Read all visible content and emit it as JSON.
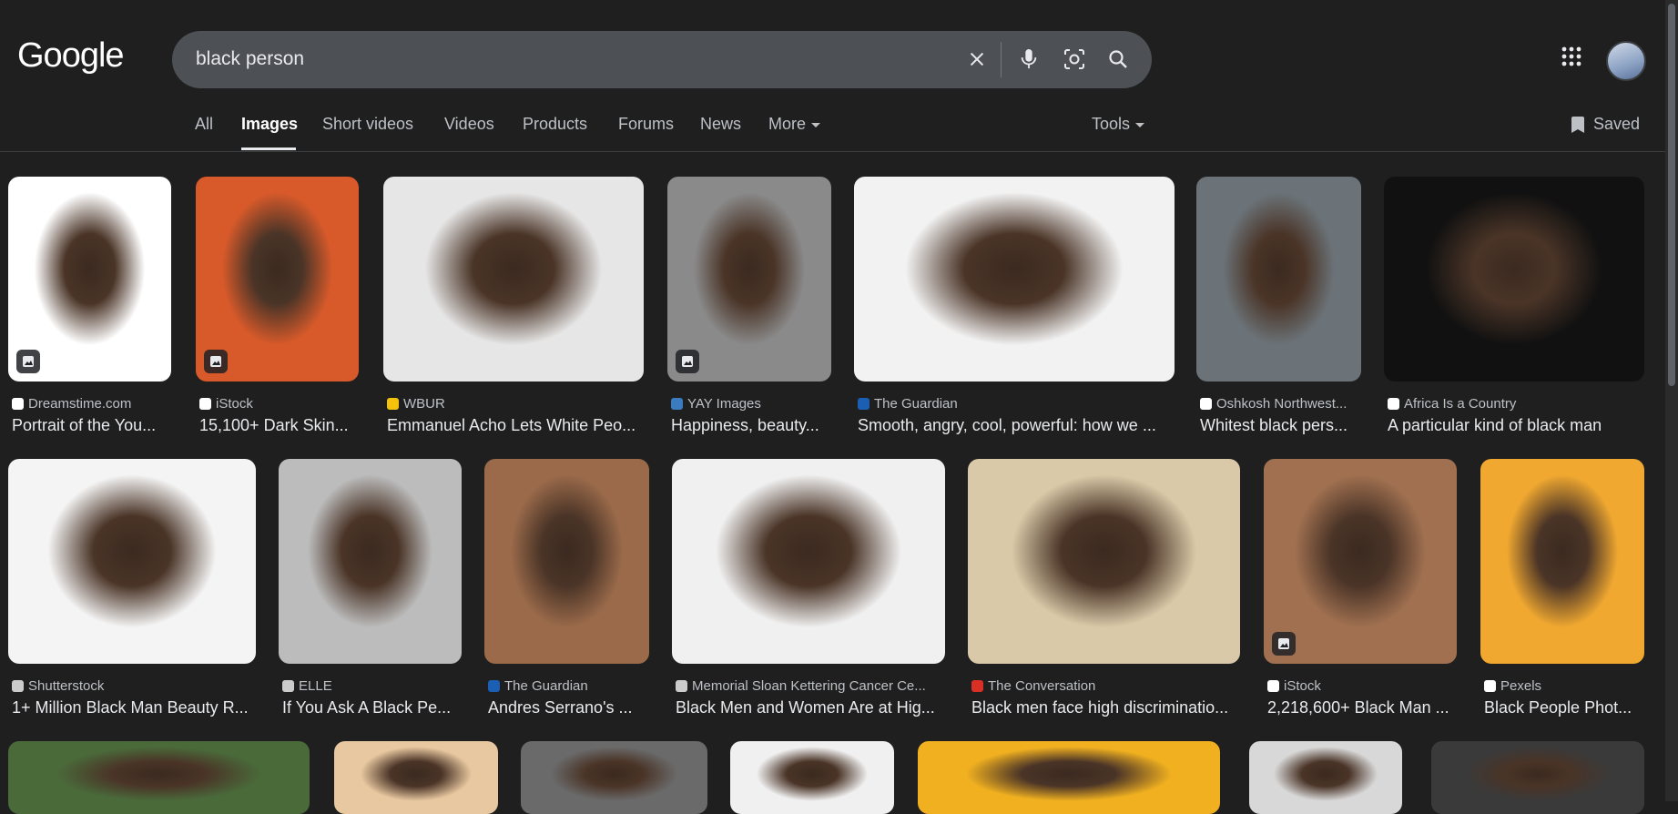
{
  "logo": "Google",
  "search": {
    "query": "black person"
  },
  "tabs": [
    "All",
    "Images",
    "Short videos",
    "Videos",
    "Products",
    "Forums",
    "News",
    "More"
  ],
  "active_tab": "Images",
  "tools_label": "Tools",
  "saved_label": "Saved",
  "results": [
    {
      "source": "Dreamstime.com",
      "title": "Portrait of the You...",
      "color": "#ffffff",
      "badge": true
    },
    {
      "source": "iStock",
      "title": "15,100+ Dark Skin...",
      "color": "#d85a2a",
      "badge": true
    },
    {
      "source": "WBUR",
      "title": "Emmanuel Acho Lets White Peo...",
      "color": "#e6e6e6",
      "badge": false
    },
    {
      "source": "YAY Images",
      "title": "Happiness, beauty...",
      "color": "#8a8a8a",
      "badge": true
    },
    {
      "source": "The Guardian",
      "title": "Smooth, angry, cool, powerful: how we ...",
      "color": "#f2f2f2",
      "badge": false
    },
    {
      "source": "Oshkosh Northwest...",
      "title": "Whitest black pers...",
      "color": "#6b7378",
      "badge": false
    },
    {
      "source": "Africa Is a Country",
      "title": "A particular kind of black man",
      "color": "#111111",
      "badge": false
    },
    {
      "source": "Shutterstock",
      "title": "1+ Million Black Man Beauty R...",
      "color": "#f4f4f4",
      "badge": false
    },
    {
      "source": "ELLE",
      "title": "If You Ask A Black Pe...",
      "color": "#bcbcbc",
      "badge": false
    },
    {
      "source": "The Guardian",
      "title": "Andres Serrano's ...",
      "color": "#9a6a4a",
      "badge": false
    },
    {
      "source": "Memorial Sloan Kettering Cancer Ce...",
      "title": "Black Men and Women Are at Hig...",
      "color": "#f0f0f0",
      "badge": false
    },
    {
      "source": "The Conversation",
      "title": "Black men face high discriminatio...",
      "color": "#d9c9a8",
      "badge": false
    },
    {
      "source": "iStock",
      "title": "2,218,600+ Black Man ...",
      "color": "#a07050",
      "badge": true
    },
    {
      "source": "Pexels",
      "title": "Black People Phot...",
      "color": "#f0a830",
      "badge": false
    },
    {
      "source": "",
      "title": "",
      "color": "#4a6a3a",
      "badge": false
    },
    {
      "source": "",
      "title": "",
      "color": "#e8c8a0",
      "badge": false
    },
    {
      "source": "",
      "title": "",
      "color": "#6a6a6a",
      "badge": false
    },
    {
      "source": "",
      "title": "",
      "color": "#f0f0f0",
      "badge": false
    },
    {
      "source": "",
      "title": "",
      "color": "#f0b020",
      "badge": false
    },
    {
      "source": "",
      "title": "",
      "color": "#d8d8d8",
      "badge": false
    },
    {
      "source": "",
      "title": "",
      "color": "#3a3a3a",
      "badge": false
    }
  ],
  "favicon_colors": [
    "#ffffff",
    "#ffffff",
    "#f4c20d",
    "#3b7bbf",
    "#1a5fb4",
    "#ffffff",
    "#ffffff",
    "#cccccc",
    "#cccccc",
    "#1a5fb4",
    "#cccccc",
    "#d93025",
    "#ffffff",
    "#ffffff"
  ]
}
